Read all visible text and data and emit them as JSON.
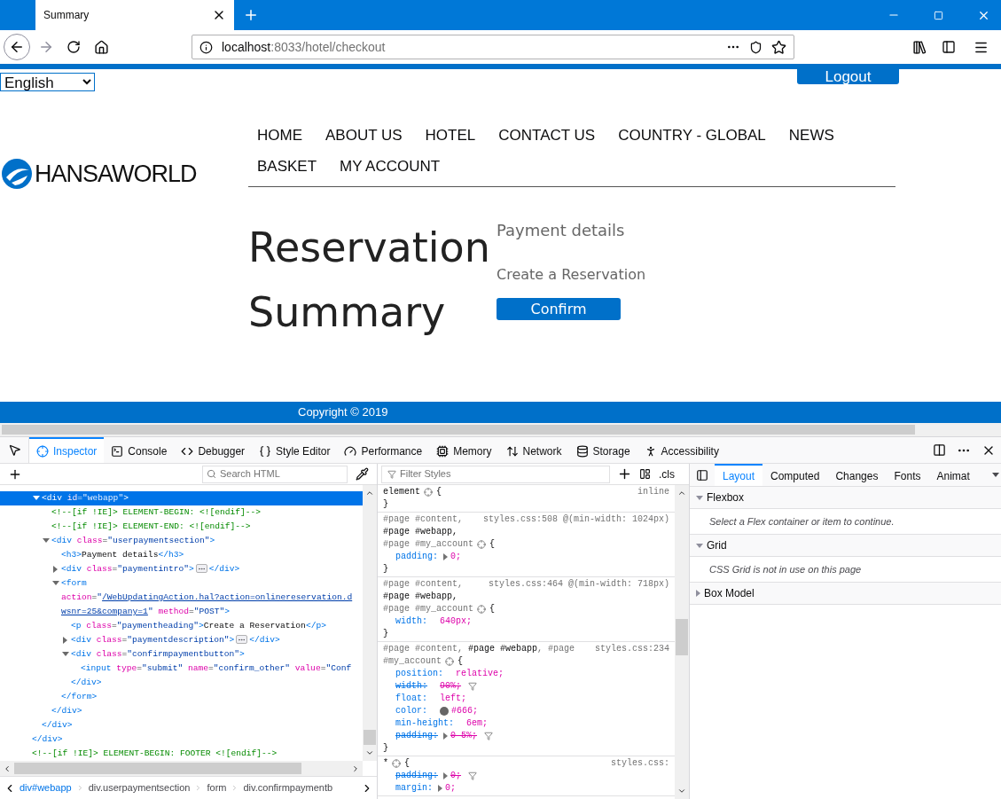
{
  "browser": {
    "tab": {
      "title": "Summary",
      "selected": true
    },
    "url": {
      "host": "localhost",
      "rest": ":8033/hotel/checkout"
    }
  },
  "page": {
    "language": "English",
    "logout": "Logout",
    "logo": "HANSAWORLD",
    "nav": [
      "HOME",
      "ABOUT US",
      "HOTEL",
      "CONTACT US",
      "COUNTRY - GLOBAL",
      "NEWS",
      "BASKET",
      "MY ACCOUNT"
    ],
    "heading": "Reservation Summary",
    "payment_title": "Payment details",
    "payment_heading": "Create a Reservation",
    "confirm": "Confirm",
    "footer": "Copyright © 2019"
  },
  "devtools": {
    "tabs": [
      {
        "label": "Inspector",
        "selected": true
      },
      {
        "label": "Console",
        "selected": false
      },
      {
        "label": "Debugger",
        "selected": false
      },
      {
        "label": "Style Editor",
        "selected": false
      },
      {
        "label": "Performance",
        "selected": false
      },
      {
        "label": "Memory",
        "selected": false
      },
      {
        "label": "Network",
        "selected": false
      },
      {
        "label": "Storage",
        "selected": false
      },
      {
        "label": "Accessibility",
        "selected": false
      }
    ],
    "markup": {
      "search_placeholder": "Search HTML",
      "tree": [
        {
          "selected": false,
          "close": [
            {
              "kind": "tag",
              "text": "</div>"
            }
          ],
          "children": [
            {
              "selected": true,
              "expanded": true,
              "lines": [
                [
                  {
                    "kind": "tag",
                    "text": "<div"
                  },
                  {
                    "kind": "attr",
                    "text": " id"
                  },
                  {
                    "kind": "eq",
                    "text": "="
                  },
                  {
                    "kind": "value",
                    "text": "\"webapp\""
                  },
                  {
                    "kind": "tag",
                    "text": ">"
                  }
                ]
              ],
              "close": [
                {
                  "kind": "tag",
                  "text": "</div>"
                }
              ],
              "children": [
                {
                  "selected": false,
                  "lines": [
                    [
                      {
                        "kind": "comment",
                        "text": "<!--[if !IE]> ELEMENT-BEGIN: <![endif]-->"
                      }
                    ]
                  ]
                },
                {
                  "selected": false,
                  "lines": [
                    [
                      {
                        "kind": "comment",
                        "text": "<!--[if !IE]> ELEMENT-END: <![endif]-->"
                      }
                    ]
                  ]
                },
                {
                  "selected": false,
                  "expanded": true,
                  "lines": [
                    [
                      {
                        "kind": "tag",
                        "text": "<div"
                      },
                      {
                        "kind": "attr",
                        "text": " class"
                      },
                      {
                        "kind": "eq",
                        "text": "="
                      },
                      {
                        "kind": "value",
                        "text": "\"userpaymentsection\""
                      },
                      {
                        "kind": "tag",
                        "text": ">"
                      }
                    ]
                  ],
                  "close": [
                    {
                      "kind": "tag",
                      "text": "</div>"
                    }
                  ],
                  "children": [
                    {
                      "selected": false,
                      "lines": [
                        [
                          {
                            "kind": "tag",
                            "text": "<h3>"
                          },
                          {
                            "kind": "text",
                            "text": "Payment details"
                          },
                          {
                            "kind": "tag",
                            "text": "</h3>"
                          }
                        ]
                      ]
                    },
                    {
                      "selected": false,
                      "expanded": false,
                      "lines": [
                        [
                          {
                            "kind": "tag",
                            "text": "<div"
                          },
                          {
                            "kind": "attr",
                            "text": " class"
                          },
                          {
                            "kind": "eq",
                            "text": "="
                          },
                          {
                            "kind": "value",
                            "text": "\"paymentintro\""
                          },
                          {
                            "kind": "tag",
                            "text": ">"
                          },
                          {
                            "kind": "badge"
                          },
                          {
                            "kind": "tag",
                            "text": "</div>"
                          }
                        ]
                      ]
                    },
                    {
                      "selected": false,
                      "expanded": true,
                      "lines": [
                        [
                          {
                            "kind": "tag",
                            "text": "<form"
                          }
                        ],
                        [
                          {
                            "kind": "attr",
                            "text": "action"
                          },
                          {
                            "kind": "eq",
                            "text": "="
                          },
                          {
                            "kind": "value",
                            "text": "\""
                          },
                          {
                            "kind": "link",
                            "text": "/WebUpdatingAction.hal?action=onlinereservation.d"
                          }
                        ],
                        [
                          {
                            "kind": "link",
                            "text": "wsnr=25&company=1"
                          },
                          {
                            "kind": "value",
                            "text": "\""
                          },
                          {
                            "kind": "attr",
                            "text": " method"
                          },
                          {
                            "kind": "eq",
                            "text": "="
                          },
                          {
                            "kind": "value",
                            "text": "\"POST\""
                          },
                          {
                            "kind": "tag",
                            "text": ">"
                          }
                        ]
                      ],
                      "close": [
                        {
                          "kind": "tag",
                          "text": "</form>"
                        }
                      ],
                      "children": [
                        {
                          "selected": false,
                          "lines": [
                            [
                              {
                                "kind": "tag",
                                "text": "<p"
                              },
                              {
                                "kind": "attr",
                                "text": " class"
                              },
                              {
                                "kind": "eq",
                                "text": "="
                              },
                              {
                                "kind": "value",
                                "text": "\"paymentheading\""
                              },
                              {
                                "kind": "tag",
                                "text": ">"
                              },
                              {
                                "kind": "text",
                                "text": "Create a Reservation"
                              },
                              {
                                "kind": "tag",
                                "text": "</p>"
                              }
                            ]
                          ]
                        },
                        {
                          "selected": false,
                          "expanded": false,
                          "lines": [
                            [
                              {
                                "kind": "tag",
                                "text": "<div"
                              },
                              {
                                "kind": "attr",
                                "text": " class"
                              },
                              {
                                "kind": "eq",
                                "text": "="
                              },
                              {
                                "kind": "value",
                                "text": "\"paymentdescription\""
                              },
                              {
                                "kind": "tag",
                                "text": ">"
                              },
                              {
                                "kind": "badge"
                              },
                              {
                                "kind": "tag",
                                "text": "</div>"
                              }
                            ]
                          ]
                        },
                        {
                          "selected": false,
                          "expanded": true,
                          "lines": [
                            [
                              {
                                "kind": "tag",
                                "text": "<div"
                              },
                              {
                                "kind": "attr",
                                "text": " class"
                              },
                              {
                                "kind": "eq",
                                "text": "="
                              },
                              {
                                "kind": "value",
                                "text": "\"confirmpaymentbutton\""
                              },
                              {
                                "kind": "tag",
                                "text": ">"
                              }
                            ]
                          ],
                          "close": [
                            {
                              "kind": "tag",
                              "text": "</div>"
                            }
                          ],
                          "children": [
                            {
                              "selected": false,
                              "lines": [
                                [
                                  {
                                    "kind": "tag",
                                    "text": "<input"
                                  },
                                  {
                                    "kind": "attr",
                                    "text": " type"
                                  },
                                  {
                                    "kind": "eq",
                                    "text": "="
                                  },
                                  {
                                    "kind": "value",
                                    "text": "\"submit\""
                                  },
                                  {
                                    "kind": "attr",
                                    "text": " name"
                                  },
                                  {
                                    "kind": "eq",
                                    "text": "="
                                  },
                                  {
                                    "kind": "value",
                                    "text": "\"confirm_other\""
                                  },
                                  {
                                    "kind": "attr",
                                    "text": " value"
                                  },
                                  {
                                    "kind": "eq",
                                    "text": "="
                                  },
                                  {
                                    "kind": "value",
                                    "text": "\"Conf"
                                  }
                                ]
                              ]
                            }
                          ]
                        }
                      ]
                    }
                  ]
                }
              ]
            }
          ]
        },
        {
          "selected": false,
          "lines": [
            [
              {
                "kind": "comment",
                "text": "<!--[if !IE]> ELEMENT-BEGIN: FOOTER <![endif]-->"
              }
            ]
          ]
        }
      ],
      "breadcrumbs": [
        {
          "label": "div#webapp",
          "selected": true
        },
        {
          "label": "div.userpaymentsection",
          "selected": false
        },
        {
          "label": "form",
          "selected": false
        },
        {
          "label": "div.confirmpaymentb",
          "selected": false
        }
      ]
    },
    "rules": {
      "filter_placeholder": "Filter Styles",
      "cls": ".cls",
      "list": [
        {
          "selector": [
            [
              {
                "text": "element",
                "matched": true
              }
            ]
          ],
          "open_brace": "{",
          "source": "inline",
          "close_brace": "}"
        },
        {
          "selector": [
            [
              {
                "text": "#page #content,",
                "matched": false
              }
            ],
            [
              {
                "text": "#page #webapp,",
                "matched": true
              }
            ],
            [
              {
                "text": "#page #my_account",
                "matched": false
              }
            ]
          ],
          "open_brace": "{",
          "source": "styles.css:508 @(min-width: 1024px)",
          "declarations": [
            {
              "name": "padding:",
              "value": "0;",
              "shorthand": true,
              "overridden": false
            }
          ],
          "close_brace": "}"
        },
        {
          "selector": [
            [
              {
                "text": "#page #content,",
                "matched": false
              }
            ],
            [
              {
                "text": "#page #webapp,",
                "matched": true
              }
            ],
            [
              {
                "text": "#page #my_account",
                "matched": false
              }
            ]
          ],
          "open_brace": "{",
          "source": "styles.css:464 @(min-width: 718px)",
          "declarations": [
            {
              "name": "width:",
              "value": "640px;",
              "shorthand": false,
              "overridden": false
            }
          ],
          "close_brace": "}"
        },
        {
          "selector": [
            [
              {
                "text": "#page #content, ",
                "matched": false
              },
              {
                "text": "#page #webapp",
                "matched": true
              },
              {
                "text": ", #page",
                "matched": false
              }
            ],
            [
              {
                "text": "#my_account",
                "matched": false
              }
            ]
          ],
          "open_brace": "{",
          "source": "styles.css:234",
          "declarations": [
            {
              "name": "position:",
              "value": "relative;",
              "shorthand": false,
              "overridden": false
            },
            {
              "name": "width:",
              "value": "90%;",
              "shorthand": false,
              "overridden": true
            },
            {
              "name": "float:",
              "value": "left;",
              "shorthand": false,
              "overridden": false
            },
            {
              "name": "color:",
              "value": "#666;",
              "shorthand": false,
              "overridden": false,
              "color": "#666666"
            },
            {
              "name": "min-height:",
              "value": "6em;",
              "shorthand": false,
              "overridden": false
            },
            {
              "name": "padding:",
              "value": "0 5%;",
              "shorthand": true,
              "overridden": true
            }
          ],
          "close_brace": "}"
        },
        {
          "selector": [
            [
              {
                "text": "*",
                "matched": true
              }
            ]
          ],
          "open_brace": "{",
          "source": "styles.css:",
          "declarations": [
            {
              "name": "padding:",
              "value": "0;",
              "shorthand": true,
              "overridden": true
            },
            {
              "name": "margin:",
              "value": "0;",
              "shorthand": true,
              "overridden": false
            }
          ]
        }
      ]
    },
    "sidebar": {
      "tabs": [
        {
          "label": "Layout",
          "selected": true
        },
        {
          "label": "Computed",
          "selected": false
        },
        {
          "label": "Changes",
          "selected": false
        },
        {
          "label": "Fonts",
          "selected": false
        },
        {
          "label": "Animat",
          "selected": false
        }
      ],
      "sections": [
        {
          "title": "Flexbox",
          "expanded": true,
          "message": "Select a Flex container or item to continue."
        },
        {
          "title": "Grid",
          "expanded": true,
          "message": "CSS Grid is not in use on this page"
        },
        {
          "title": "Box Model",
          "expanded": false
        }
      ]
    }
  }
}
